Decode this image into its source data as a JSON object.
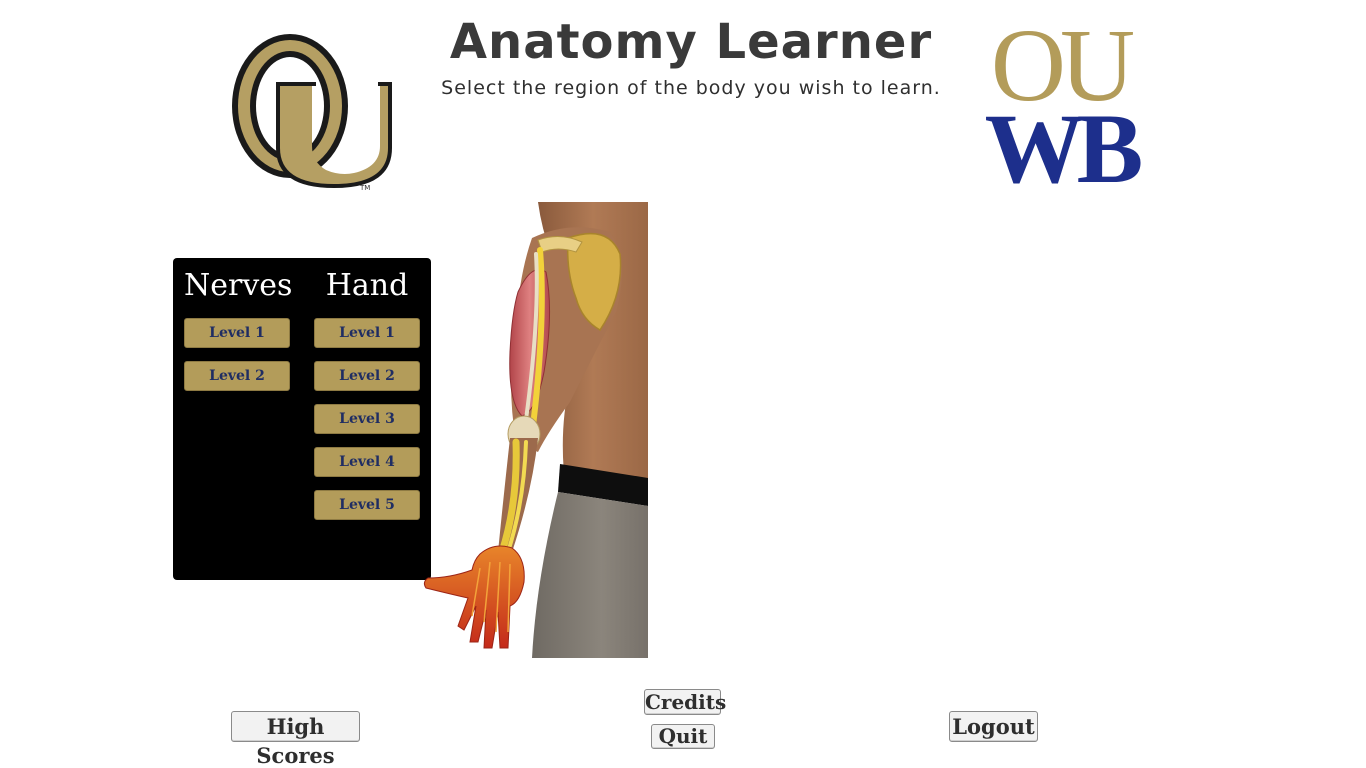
{
  "header": {
    "title": "Anatomy Learner",
    "subtitle": "Select the region of the body you wish to learn."
  },
  "logos": {
    "left": {
      "icon": "ou-monogram-logo",
      "text": "OU",
      "tm": "TM",
      "colors": {
        "gold": "#b59f63",
        "outline": "#1a1a1a"
      }
    },
    "right": {
      "icon": "ouwb-logo",
      "top": "OU",
      "bottom": "WB",
      "colors": {
        "gold": "#b39c5a",
        "blue": "#1d2f8c"
      }
    }
  },
  "menu": {
    "columns": [
      {
        "heading": "Nerves",
        "levels": [
          "Level 1",
          "Level 2"
        ]
      },
      {
        "heading": "Hand",
        "levels": [
          "Level 1",
          "Level 2",
          "Level 3",
          "Level 4",
          "Level 5"
        ]
      }
    ],
    "colors": {
      "panel": "#000000",
      "button": "#b39c5a",
      "button_text": "#1f2d63"
    }
  },
  "figure": {
    "icon": "arm-anatomy-illustration"
  },
  "footer": {
    "high_scores": "High Scores",
    "credits": "Credits",
    "quit": "Quit",
    "logout": "Logout"
  }
}
